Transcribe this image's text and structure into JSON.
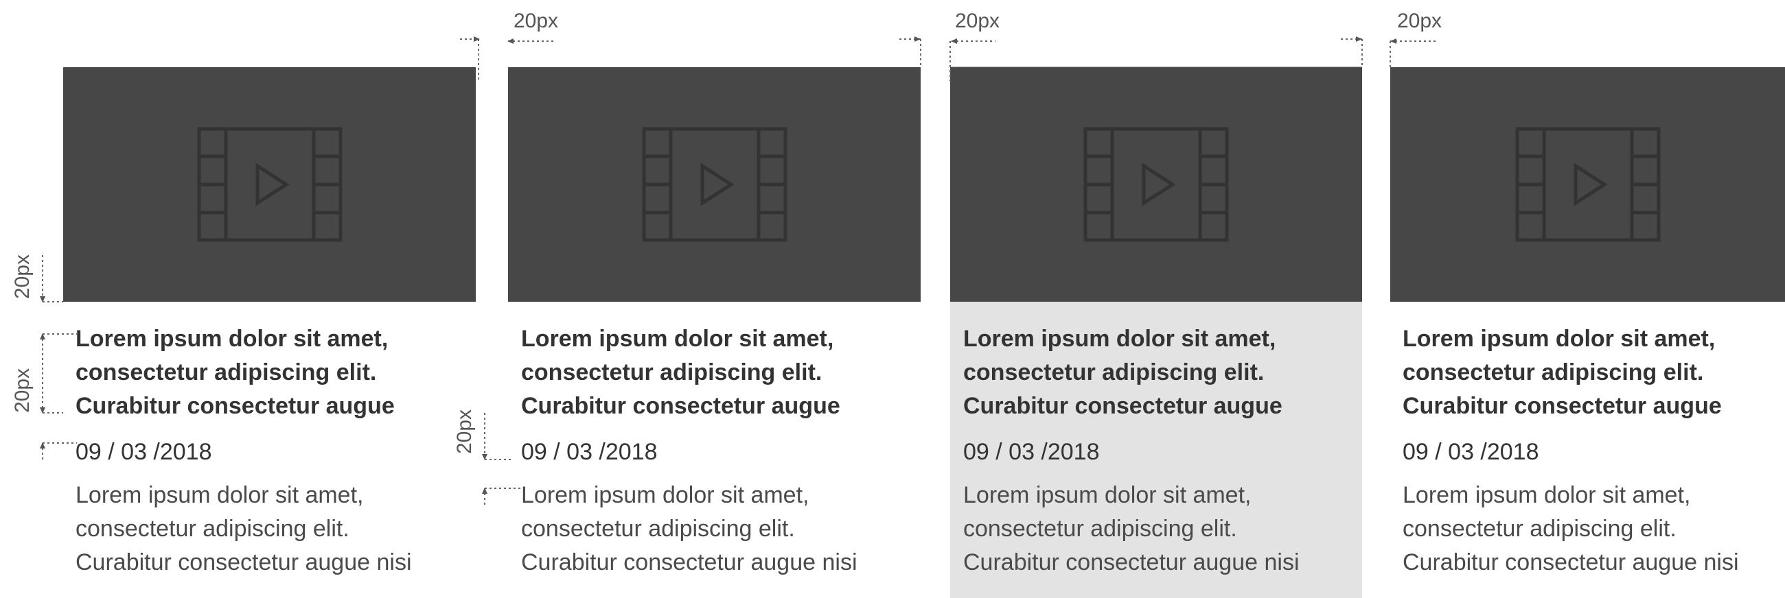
{
  "annotations": {
    "spacing_label": "20px"
  },
  "cards": [
    {
      "title": "Lorem ipsum dolor sit amet,\nconsectetur adipiscing elit.\nCurabitur consectetur augue",
      "date": "09 / 03 /2018",
      "description": "Lorem ipsum dolor sit amet,\nconsectetur adipiscing elit.\nCurabitur consectetur augue nisi"
    },
    {
      "title": "Lorem ipsum dolor sit amet,\nconsectetur adipiscing elit.\nCurabitur consectetur augue",
      "date": "09 / 03 /2018",
      "description": "Lorem ipsum dolor sit amet,\nconsectetur adipiscing elit.\nCurabitur consectetur augue nisi"
    },
    {
      "title": "Lorem ipsum dolor sit amet,\nconsectetur adipiscing elit.\nCurabitur consectetur augue",
      "date": "09 / 03 /2018",
      "description": "Lorem ipsum dolor sit amet,\nconsectetur adipiscing elit.\nCurabitur consectetur augue nisi",
      "highlighted": true
    },
    {
      "title": "Lorem ipsum dolor sit amet,\nconsectetur adipiscing elit.\nCurabitur consectetur augue",
      "date": "09 / 03 /2018",
      "description": "Lorem ipsum dolor sit amet,\nconsectetur adipiscing elit.\nCurabitur consectetur augue nisi"
    }
  ],
  "colors": {
    "thumbnail": "#474747",
    "icon_stroke": "#333333",
    "highlight_bg": "#e3e3e3",
    "text": "#333333"
  },
  "icons": {
    "thumbnail_icon": "film-play-icon"
  }
}
